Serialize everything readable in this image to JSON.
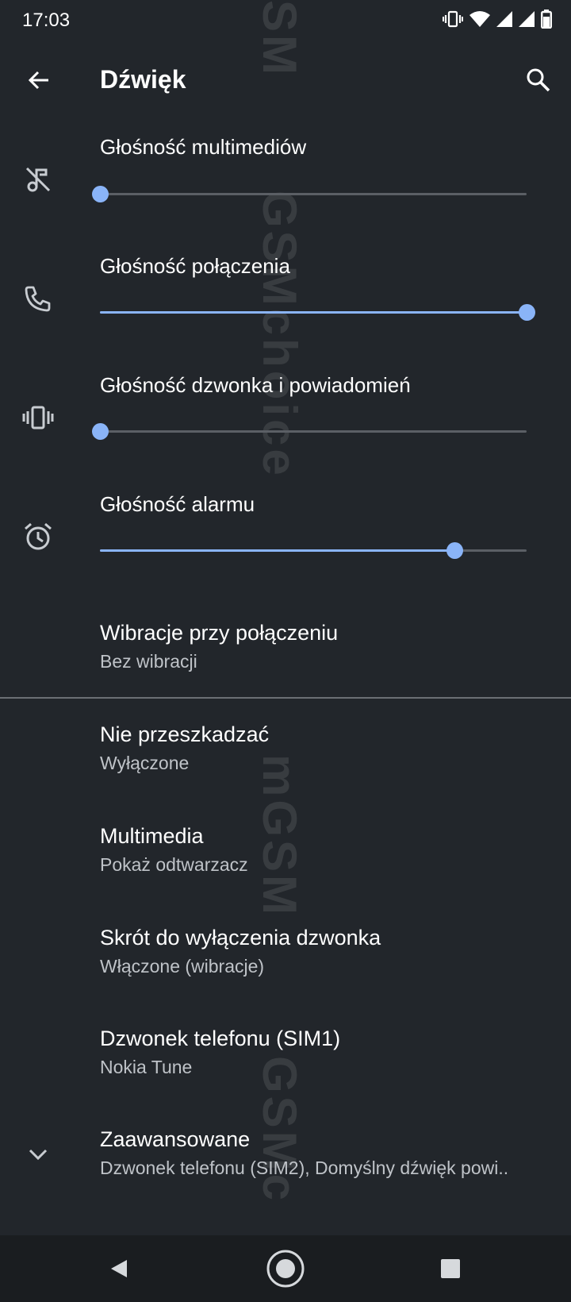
{
  "status_bar": {
    "time": "17:03",
    "icons": [
      "vibrate-icon",
      "wifi-icon",
      "signal-icon",
      "signal-icon",
      "battery-icon"
    ]
  },
  "app_bar": {
    "title": "Dźwięk",
    "back_icon": "arrow-back-icon",
    "search_icon": "search-icon"
  },
  "volumes": [
    {
      "label": "Głośność multimediów",
      "icon": "music-off-icon",
      "level": 0.0
    },
    {
      "label": "Głośność połączenia",
      "icon": "phone-icon",
      "level": 1.0
    },
    {
      "label": "Głośność dzwonka i powiadomień",
      "icon": "vibrate-icon",
      "level": 0.0
    },
    {
      "label": "Głośność alarmu",
      "icon": "alarm-icon",
      "level": 0.83
    }
  ],
  "preferences": [
    {
      "title": "Wibracje przy połączeniu",
      "summary": "Bez wibracji"
    },
    {
      "title": "Nie przeszkadzać",
      "summary": "Wyłączone"
    },
    {
      "title": "Multimedia",
      "summary": "Pokaż odtwarzacz"
    },
    {
      "title": "Skrót do wyłączenia dzwonka",
      "summary": "Włączone (wibracje)"
    },
    {
      "title": "Dzwonek telefonu (SIM1)",
      "summary": "Nokia Tune"
    },
    {
      "title": "Zaawansowane",
      "summary": "Dzwonek telefonu (SIM2), Domyślny dźwięk powi..",
      "icon": "chevron-down-icon"
    }
  ],
  "watermarks": [
    "SM",
    "GSMchoice",
    "mGSM",
    "GSMc"
  ],
  "nav_bar": {
    "buttons": [
      "back-triangle-icon",
      "home-circle-icon",
      "recents-square-icon"
    ]
  },
  "colors": {
    "background": "#22262b",
    "accent": "#8ab4f8",
    "track": "#5b5f65"
  }
}
